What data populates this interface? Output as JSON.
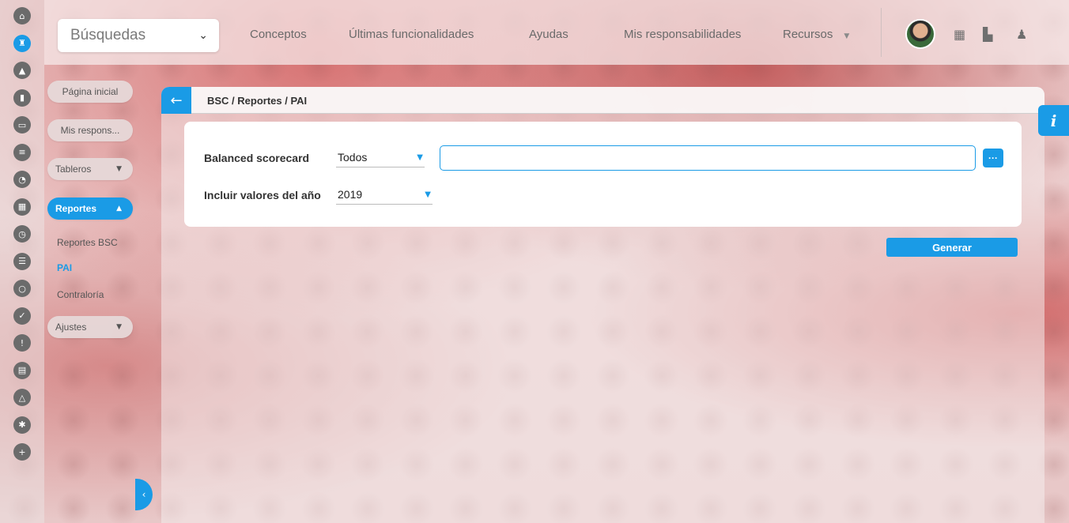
{
  "search": {
    "label": "Búsquedas"
  },
  "nav": {
    "items": [
      "Conceptos",
      "Últimas funcionalidades",
      "Ayudas",
      "Mis responsabilidades",
      "Recursos"
    ]
  },
  "rail": {
    "icons": [
      "home-icon",
      "castle-icon",
      "pyramid-icon",
      "chart-icon",
      "board-icon",
      "balance-icon",
      "pie-icon",
      "map-icon",
      "clock-icon",
      "document-icon",
      "cycle-icon",
      "check-icon",
      "warning-icon",
      "calendar-icon",
      "triangle-network-icon",
      "gear-icon",
      "plus-icon"
    ]
  },
  "sidebar": {
    "home": "Página inicial",
    "responsibilities": "Mis respons...",
    "dashboards": "Tableros",
    "reports": "Reportes",
    "reports_items": [
      "Reportes BSC",
      "PAI",
      "Contraloría"
    ],
    "settings": "Ajustes"
  },
  "header": {
    "breadcrumb": "BSC / Reportes / PAI"
  },
  "form": {
    "scorecard_label": "Balanced scorecard",
    "scorecard_value": "Todos",
    "scorecard_text": "",
    "year_label": "Incluir valores del año",
    "year_value": "2019",
    "generate_label": "Generar"
  },
  "colors": {
    "accent": "#1a9be6"
  }
}
